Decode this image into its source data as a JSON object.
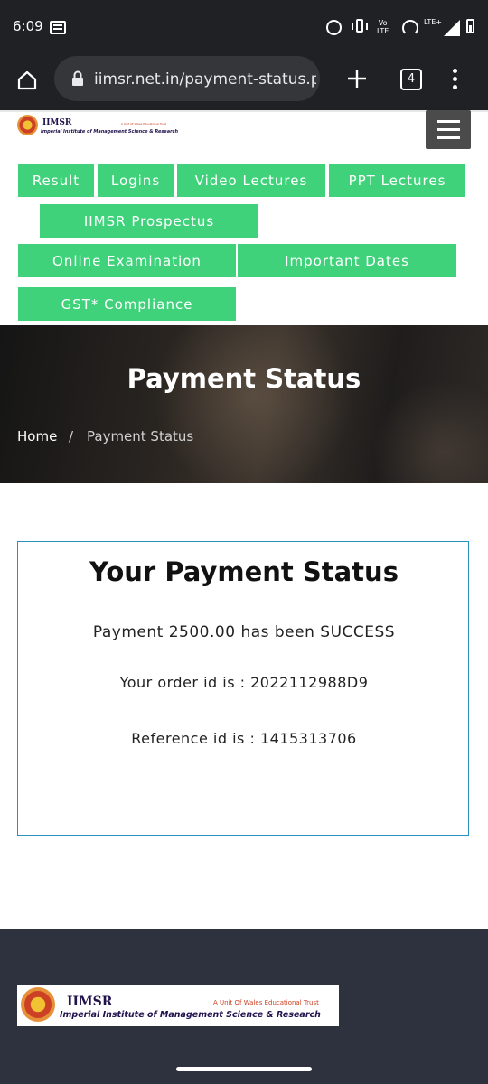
{
  "status_bar": {
    "time": "6:09",
    "volte_label": "Vo\nLTE",
    "lte_label": "LTE+"
  },
  "browser": {
    "url": "iimsr.net.in/payment-status.ph",
    "tab_count": "4"
  },
  "header": {
    "logo_name": "IIMSR",
    "logo_full": "Imperial Institute of Management Science & Research",
    "logo_unit": "A Unit Of Wales Educational Trust"
  },
  "nav": {
    "result": "Result",
    "logins": "Logins",
    "video_lectures": "Video Lectures",
    "ppt_lectures": "PPT Lectures",
    "prospectus": "IIMSR Prospectus",
    "online_exam": "Online Examination",
    "important_dates": "Important Dates",
    "gst": "GST* Compliance"
  },
  "hero": {
    "title": "Payment Status",
    "breadcrumb_home": "Home",
    "breadcrumb_sep": "/",
    "breadcrumb_current": "Payment Status"
  },
  "status_box": {
    "title": "Your Payment Status",
    "payment_line": "Payment 2500.00 has been SUCCESS",
    "order_line": "Your order id is : 2022112988D9",
    "reference_line": "Reference id is : 1415313706"
  },
  "footer": {
    "logo_name": "IIMSR",
    "logo_full": "Imperial Institute of Management Science & Research",
    "logo_unit": "A Unit Of Wales Educational Trust"
  }
}
